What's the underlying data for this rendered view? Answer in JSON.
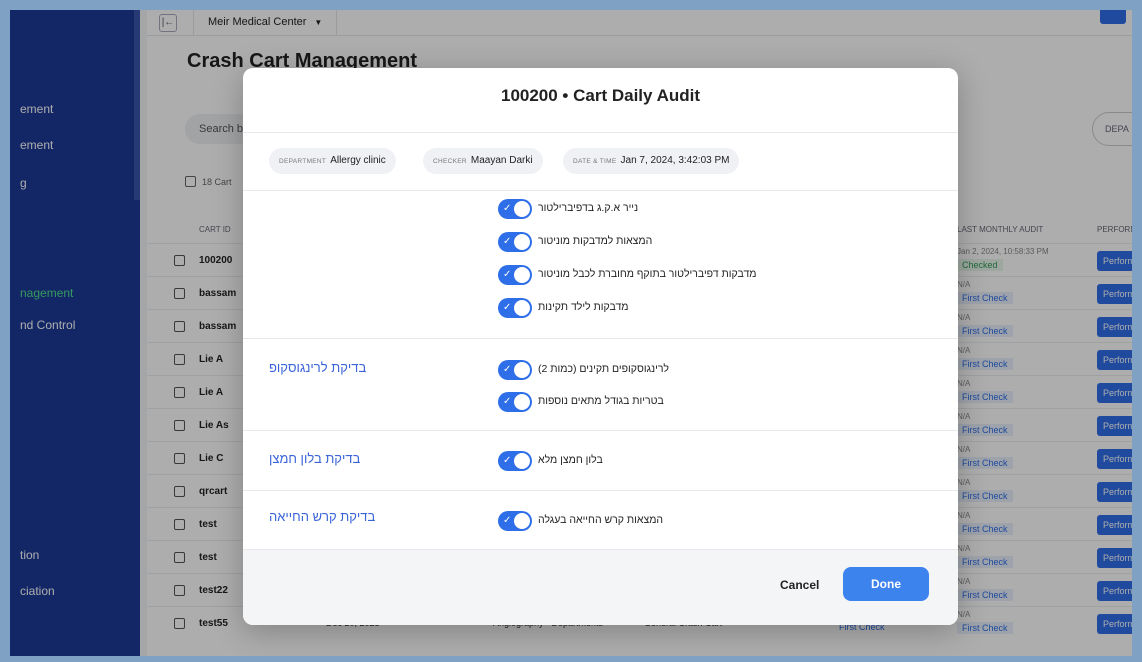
{
  "sidebar": {
    "items": [
      {
        "label": "ement"
      },
      {
        "label": "ement"
      },
      {
        "label": "g"
      },
      {
        "label": "nagement"
      },
      {
        "label": "nd Control"
      },
      {
        "label": "tion"
      },
      {
        "label": "ciation"
      }
    ]
  },
  "topbar": {
    "organization": "Meir Medical Center"
  },
  "page": {
    "title": "Crash Cart Management",
    "search_placeholder": "Search b",
    "department_filter": "DEPA",
    "cart_count": "18 Cart"
  },
  "table": {
    "headers": {
      "cart_id": "CART ID",
      "last_monthly_audit": "LAST MONTHLY AUDIT",
      "perform": "PERFORM"
    },
    "rows": [
      {
        "cart_id": "100200",
        "ma_date": "Jan 2, 2024, 10:58:33 PM",
        "ma_status": "Checked",
        "perform": "Perform"
      },
      {
        "cart_id": "bassam",
        "ma_date": "N/A",
        "ma_status": "First Check",
        "perform": "Perform"
      },
      {
        "cart_id": "bassam",
        "ma_date": "N/A",
        "ma_status": "First Check",
        "perform": "Perform"
      },
      {
        "cart_id": "Lie A",
        "ma_date": "N/A",
        "ma_status": "First Check",
        "perform": "Perform"
      },
      {
        "cart_id": "Lie A",
        "ma_date": "N/A",
        "ma_status": "First Check",
        "perform": "Perform"
      },
      {
        "cart_id": "Lie As",
        "ma_date": "N/A",
        "ma_status": "First Check",
        "perform": "Perform"
      },
      {
        "cart_id": "Lie C",
        "ma_date": "N/A",
        "ma_status": "First Check",
        "perform": "Perform"
      },
      {
        "cart_id": "qrcart",
        "ma_date": "N/A",
        "ma_status": "First Check",
        "perform": "Perform"
      },
      {
        "cart_id": "test",
        "ma_date": "N/A",
        "ma_status": "First Check",
        "perform": "Perform"
      },
      {
        "cart_id": "test",
        "ma_date": "N/A",
        "ma_status": "First Check",
        "perform": "Perform"
      },
      {
        "cart_id": "test22",
        "ma_date": "N/A",
        "ma_status": "First Check",
        "perform": "Perform"
      },
      {
        "cart_id": "test55",
        "date": "Dec 20, 2023",
        "dept": "Angiography - Departments",
        "type": "General Crash Cart",
        "ma1_date": "N/A",
        "ma1_status": "First Check",
        "ma_date": "N/A",
        "ma_status": "First Check",
        "perform": "Perform"
      }
    ]
  },
  "modal": {
    "title": "100200 • Cart Daily Audit",
    "chips": [
      {
        "label": "DEPARTMENT",
        "value": "Allergy clinic"
      },
      {
        "label": "CHECKER",
        "value": "Maayan Darki"
      },
      {
        "label": "DATE & TIME",
        "value": "Jan 7, 2024, 3:42:03 PM"
      }
    ],
    "sections": [
      {
        "title": "",
        "items": [
          "נייר א.ק.ג בדפיברילטור",
          "המצאות למדבקות מוניטור",
          "מדבקות דפיברילטור בתוקף מחוברת לכבל מוניטור",
          "מדבקות לילד תקינות"
        ]
      },
      {
        "title": "בדיקת לרינגוסקופ",
        "items": [
          "לרינגוסקופים תקינים (כמות 2)",
          "בטריות בגודל מתאים נוספות"
        ]
      },
      {
        "title": "בדיקת בלון חמצן",
        "items": [
          "בלון חמצן מלא"
        ]
      },
      {
        "title": "בדיקת קרש החייאה",
        "items": [
          "המצאות קרש החייאה בעגלה"
        ]
      }
    ],
    "toggle_state": true,
    "cancel_label": "Cancel",
    "done_label": "Done"
  },
  "colors": {
    "accent": "#2e6ee8",
    "sidebar": "#1c3a98",
    "section_title": "#3a64d8"
  },
  "icons": [
    "collapse-sidebar-icon",
    "chevron-down-icon",
    "checkbox-icon",
    "check-icon"
  ]
}
